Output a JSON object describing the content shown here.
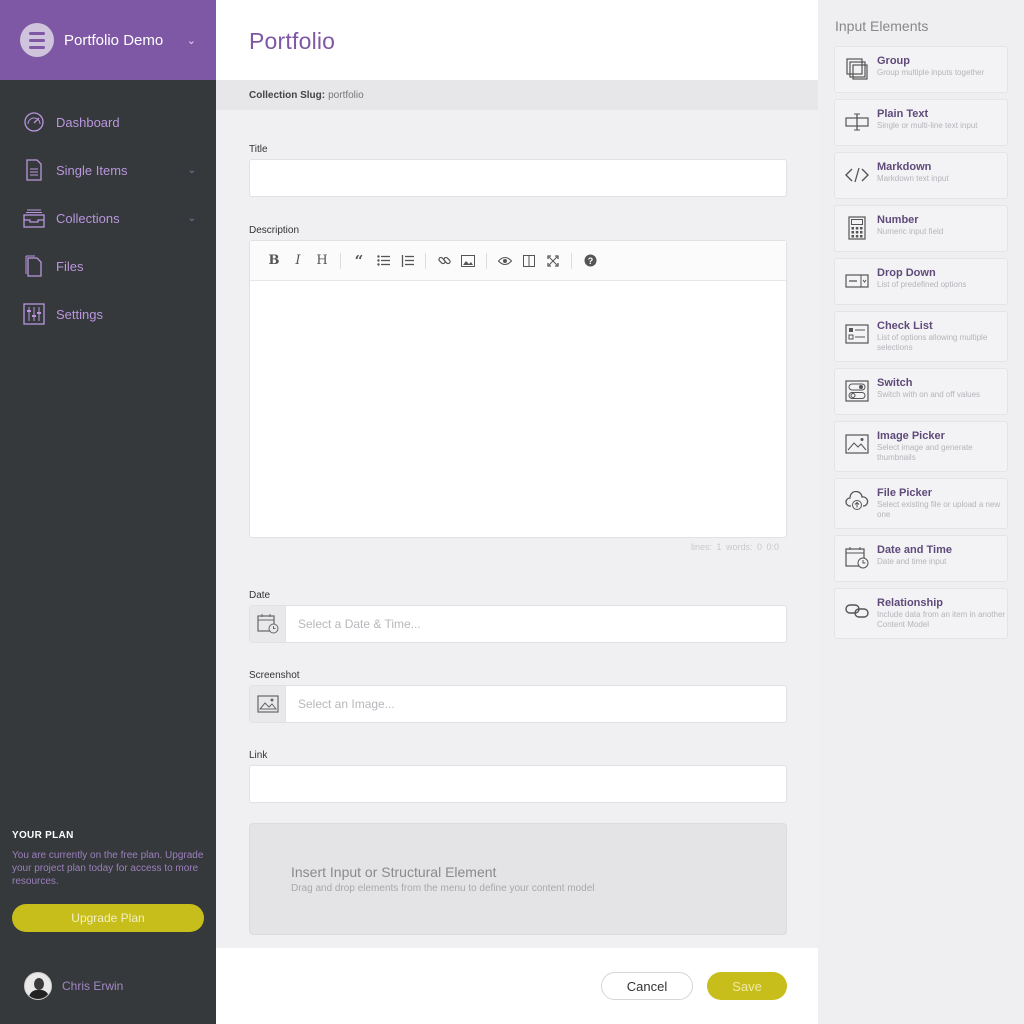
{
  "sidebar": {
    "project_name": "Portfolio Demo",
    "nav": [
      {
        "label": "Dashboard",
        "icon": "dashboard-gauge-icon",
        "has_submenu": false
      },
      {
        "label": "Single Items",
        "icon": "document-icon",
        "has_submenu": true
      },
      {
        "label": "Collections",
        "icon": "inbox-tray-icon",
        "has_submenu": true
      },
      {
        "label": "Files",
        "icon": "files-icon",
        "has_submenu": false
      },
      {
        "label": "Settings",
        "icon": "sliders-icon",
        "has_submenu": false
      }
    ],
    "plan": {
      "title": "YOUR PLAN",
      "text": "You are currently on the free plan. Upgrade your project plan today for access to more resources.",
      "upgrade_label": "Upgrade Plan"
    },
    "user": {
      "name": "Chris Erwin"
    }
  },
  "main": {
    "title": "Portfolio",
    "slug_label": "Collection Slug:",
    "slug_value": "portfolio",
    "fields": {
      "title_label": "Title",
      "description_label": "Description",
      "date_label": "Date",
      "date_placeholder": "Select a Date & Time...",
      "screenshot_label": "Screenshot",
      "screenshot_placeholder": "Select an Image...",
      "link_label": "Link"
    },
    "editor_status": "lines: 1    words: 0    0:0",
    "dropzone": {
      "title": "Insert Input or Structural Element",
      "subtitle": "Drag and drop elements from the menu to define your content model"
    },
    "footer": {
      "cancel_label": "Cancel",
      "save_label": "Save"
    }
  },
  "right_panel": {
    "title": "Input Elements",
    "elements": [
      {
        "name": "Group",
        "desc": "Group multiple inputs together",
        "icon": "group-icon"
      },
      {
        "name": "Plain Text",
        "desc": "Single or multi-line text input",
        "icon": "text-cursor-icon"
      },
      {
        "name": "Markdown",
        "desc": "Markdown text input",
        "icon": "code-icon"
      },
      {
        "name": "Number",
        "desc": "Numeric input field",
        "icon": "calculator-icon"
      },
      {
        "name": "Drop Down",
        "desc": "List of predefined options",
        "icon": "dropdown-icon"
      },
      {
        "name": "Check List",
        "desc": "List of options allowing multiple selections",
        "icon": "checklist-icon"
      },
      {
        "name": "Switch",
        "desc": "Switch with on and off values",
        "icon": "switch-icon"
      },
      {
        "name": "Image Picker",
        "desc": "Select image and generate thumbnails",
        "icon": "image-icon"
      },
      {
        "name": "File Picker",
        "desc": "Select existing file or upload a new one",
        "icon": "cloud-upload-icon"
      },
      {
        "name": "Date and Time",
        "desc": "Date and time input",
        "icon": "calendar-clock-icon"
      },
      {
        "name": "Relationship",
        "desc": "Include data from an item in another Content Model",
        "icon": "link-chain-icon"
      }
    ]
  },
  "colors": {
    "brand_purple": "#7f58a5",
    "sidebar_bg": "#36393c",
    "accent_yellow": "#c8be1b"
  }
}
